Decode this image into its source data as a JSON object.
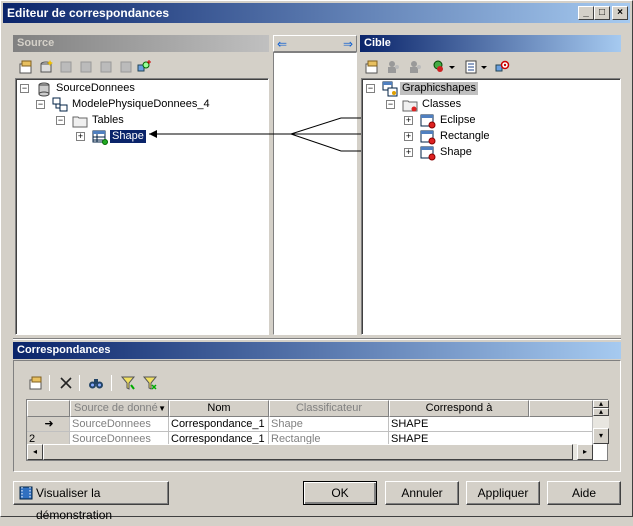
{
  "window": {
    "title": "Editeur de correspondances",
    "controls": [
      "_",
      "□",
      "×"
    ]
  },
  "source": {
    "header": "Source",
    "tree": [
      {
        "label": "SourceDonnees",
        "icon": "database-icon",
        "expander": "−"
      },
      {
        "label": "ModelePhysiqueDonnees_4",
        "icon": "physical-model-icon",
        "expander": "−"
      },
      {
        "label": "Tables",
        "icon": "folder-icon",
        "expander": "−"
      },
      {
        "label": "Shape",
        "icon": "table-icon",
        "expander": "+",
        "selected": true
      }
    ]
  },
  "middle": {
    "left_arrow": "⇐",
    "right_arrow": "⇒"
  },
  "target": {
    "header": "Cible",
    "tree": [
      {
        "label": "Graphicshapes",
        "icon": "class-model-icon",
        "expander": "−",
        "selected": true
      },
      {
        "label": "Classes",
        "icon": "folder-icon",
        "expander": "−"
      },
      {
        "label": "Eclipse",
        "icon": "class-icon",
        "expander": "+"
      },
      {
        "label": "Rectangle",
        "icon": "class-icon",
        "expander": "+"
      },
      {
        "label": "Shape",
        "icon": "class-icon",
        "expander": "+"
      }
    ]
  },
  "mappings": {
    "header": "Correspondances",
    "columns": [
      "Source de donné",
      "Nom",
      "Classificateur",
      "Correspond à"
    ],
    "rows": [
      {
        "marker": "➜",
        "source": "SourceDonnees",
        "name": "Correspondance_1",
        "classifier": "Shape",
        "maps_to": "SHAPE"
      },
      {
        "marker": "2",
        "source": "SourceDonnees",
        "name": "Correspondance_1",
        "classifier": "Rectangle",
        "maps_to": "SHAPE"
      }
    ]
  },
  "buttons": {
    "demo": "Visualiser la démonstration",
    "ok": "OK",
    "cancel": "Annuler",
    "apply": "Appliquer",
    "help": "Aide"
  }
}
